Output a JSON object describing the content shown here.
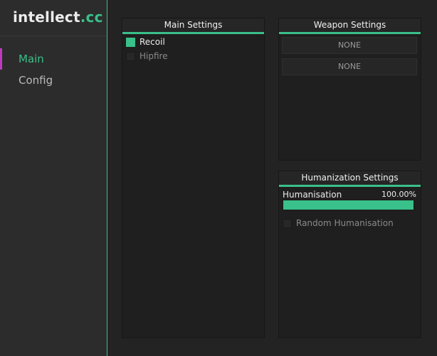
{
  "logo": {
    "brand": "intellect",
    "tld": ".cc"
  },
  "sidebar": {
    "items": [
      {
        "label": "Main",
        "active": true
      },
      {
        "label": "Config",
        "active": false
      }
    ]
  },
  "main_settings": {
    "title": "Main Settings",
    "options": [
      {
        "label": "Recoil",
        "checked": true
      },
      {
        "label": "Hipfire",
        "checked": false
      }
    ]
  },
  "weapon_settings": {
    "title": "Weapon Settings",
    "slots": [
      "NONE",
      "NONE"
    ]
  },
  "humanization_settings": {
    "title": "Humanization Settings",
    "slider": {
      "label": "Humanisation",
      "value_text": "100.00%",
      "value": 1.0
    },
    "option": {
      "label": "Random Humanisation",
      "checked": false
    }
  },
  "colors": {
    "accent": "#3ac08a",
    "active_marker": "#c03ac0",
    "background": "#232323",
    "sidebar": "#2c2c2c"
  }
}
